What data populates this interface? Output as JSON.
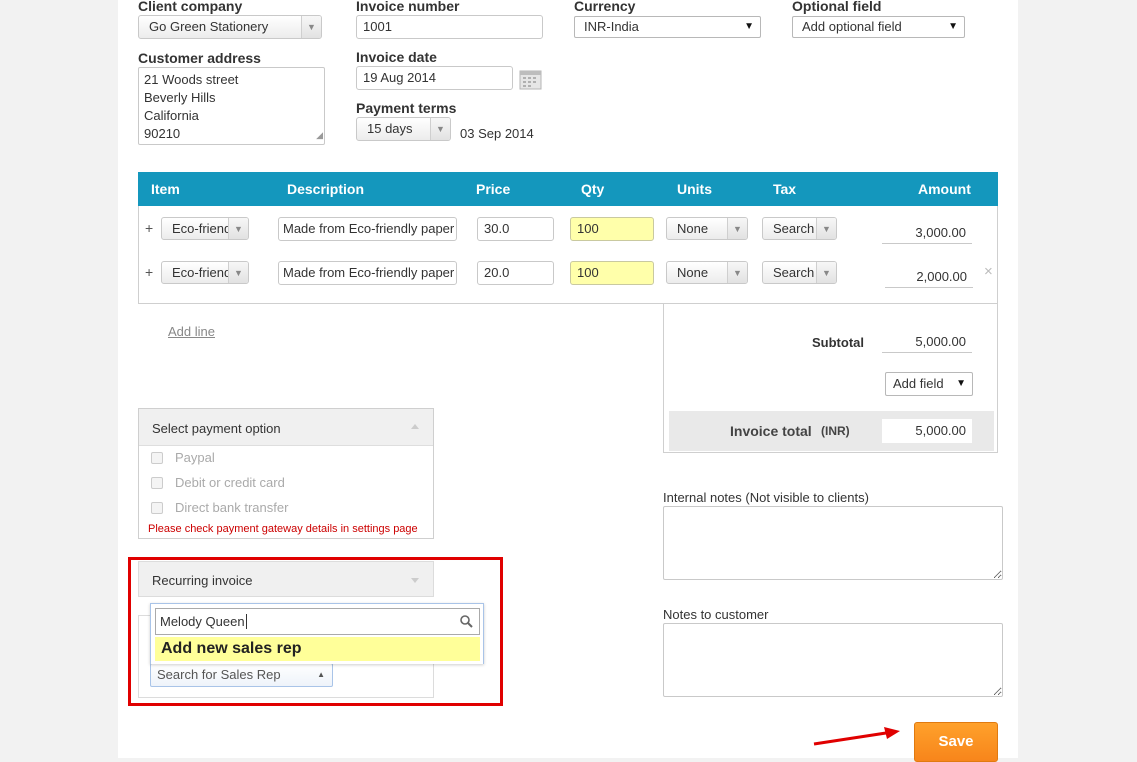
{
  "client": {
    "label": "Client company",
    "value": "Go Green Stationery",
    "address_label": "Customer address",
    "address_lines": [
      "21 Woods street",
      "Beverly Hills",
      "California",
      "90210"
    ]
  },
  "invoice": {
    "number_label": "Invoice number",
    "number": "1001",
    "date_label": "Invoice date",
    "date": "19 Aug 2014",
    "terms_label": "Payment terms",
    "terms": "15 days",
    "due_date": "03 Sep 2014"
  },
  "currency": {
    "label": "Currency",
    "value": "INR-India"
  },
  "optional": {
    "label": "Optional field",
    "value": "Add optional field"
  },
  "table": {
    "headers": [
      "Item",
      "Description",
      "Price",
      "Qty",
      "Units",
      "Tax",
      "Amount"
    ],
    "rows": [
      {
        "add": "+",
        "item": "Eco-friend",
        "description": "Made from Eco-friendly paper",
        "price": "30.0",
        "qty": "100",
        "units": "None",
        "tax": "Search",
        "amount": "3,000.00",
        "remove": ""
      },
      {
        "add": "+",
        "item": "Eco-friend",
        "description": "Made from Eco-friendly paper",
        "price": "20.0",
        "qty": "100",
        "units": "None",
        "tax": "Search",
        "amount": "2,000.00",
        "remove": "×"
      }
    ],
    "add_line": "Add line"
  },
  "totals": {
    "subtotal_label": "Subtotal",
    "subtotal": "5,000.00",
    "add_field": "Add field",
    "total_label": "Invoice total",
    "total_currency": "(INR)",
    "total": "5,000.00"
  },
  "payment": {
    "header": "Select payment option",
    "options": [
      "Paypal",
      "Debit or credit card",
      "Direct bank transfer"
    ],
    "warning": "Please check payment gateway details in settings page"
  },
  "recurring": {
    "header": "Recurring invoice"
  },
  "sales_rep": {
    "search_value": "Melody Queen",
    "add_new": "Add new sales rep",
    "select_placeholder": "Search for Sales Rep"
  },
  "notes": {
    "internal_label": "Internal notes (Not visible to clients)",
    "customer_label": "Notes to customer"
  },
  "actions": {
    "save": "Save"
  },
  "colors": {
    "header_bg": "#1497bd",
    "qty_highlight": "#ffffaa",
    "save_orange": "#f7931e",
    "annotation_red": "#e00000"
  }
}
